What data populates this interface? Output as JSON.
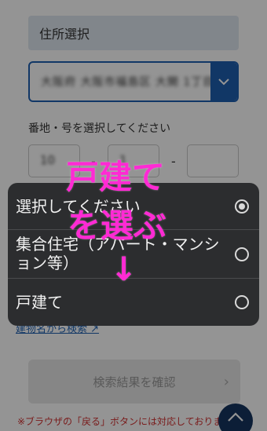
{
  "form": {
    "section_title": "住所選択",
    "address_value": "大阪府 大阪市福島区 大開 1丁目",
    "banchi_label": "番地・号を選択してください",
    "banchi_value_1": "10",
    "banchi_value_2": "1",
    "separator": "-",
    "search_link": "建物名から検索 ↗",
    "confirm_button": "検索結果を確認",
    "confirm_arrow": "›",
    "note": "※ブラウザの「戻る」ボタンには対応しておりません"
  },
  "picker": {
    "options": [
      {
        "label": "選択してください",
        "selected": true
      },
      {
        "label": "集合住宅（アパート・マンション等）",
        "selected": false
      },
      {
        "label": "戸建て",
        "selected": false
      }
    ]
  },
  "annotation": {
    "line1": "戸建て",
    "line2": "を選ぶ",
    "arrow": "↓"
  },
  "colors": {
    "accent": "#1e5fb0",
    "annotation": "#ff2ad4",
    "picker_bg": "#2c2d2f"
  }
}
